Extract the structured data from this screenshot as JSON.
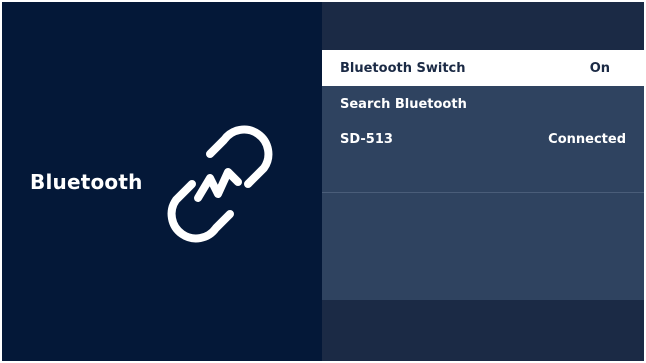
{
  "left_panel": {
    "title": "Bluetooth",
    "icon": "bluetooth-link-icon"
  },
  "menu": {
    "items": [
      {
        "label": "Bluetooth Switch",
        "value": "On",
        "selected": true
      },
      {
        "label": "Search Bluetooth",
        "value": "",
        "selected": false
      },
      {
        "label": "SD-513",
        "value": "Connected",
        "selected": false
      }
    ]
  },
  "colors": {
    "left_bg": "#041838",
    "right_bg": "#1b2a45",
    "menu_bg": "#2f4360",
    "selected_bg": "#ffffff",
    "selected_text": "#1b2a45",
    "text": "#ffffff"
  }
}
